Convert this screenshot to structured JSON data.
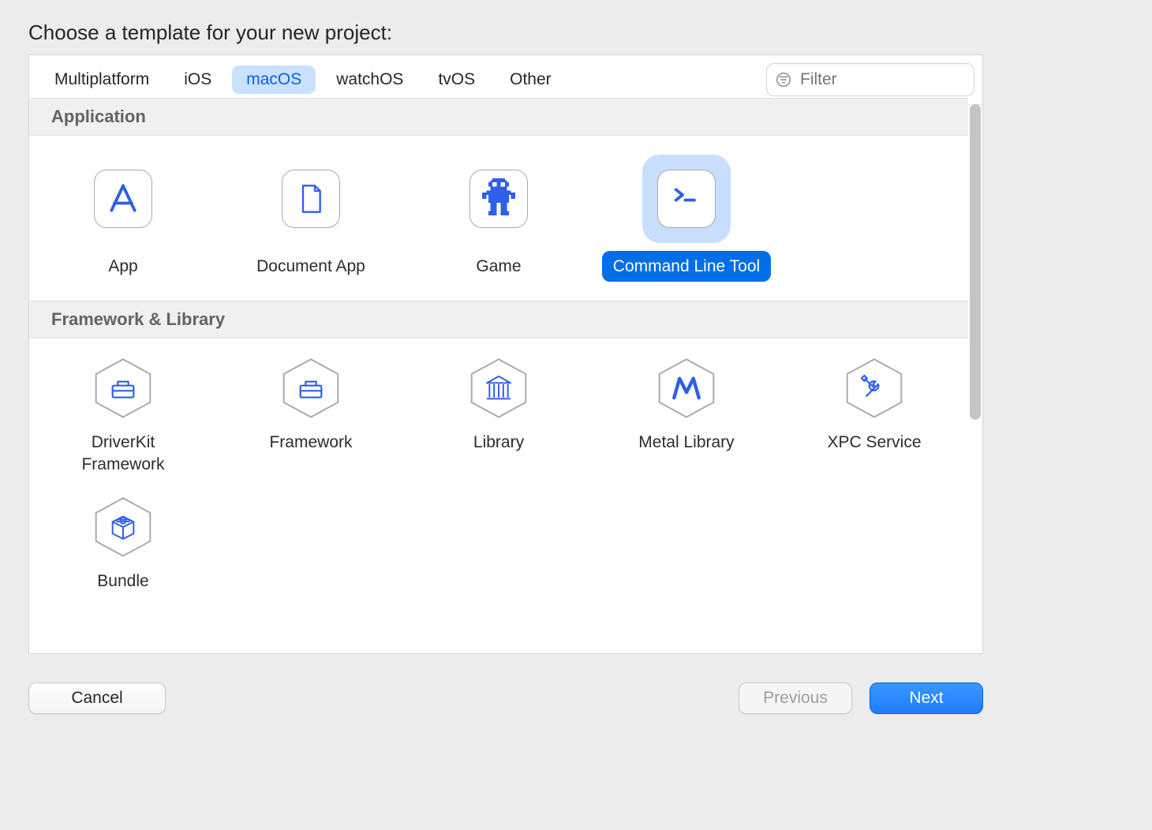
{
  "prompt": "Choose a template for your new project:",
  "tabs": [
    "Multiplatform",
    "iOS",
    "macOS",
    "watchOS",
    "tvOS",
    "Other"
  ],
  "active_tab": "macOS",
  "filter_placeholder": "Filter",
  "sections": {
    "application": {
      "title": "Application",
      "items": [
        {
          "label": "App",
          "icon": "app-a-icon",
          "selected": false
        },
        {
          "label": "Document App",
          "icon": "document-icon",
          "selected": false
        },
        {
          "label": "Game",
          "icon": "game-sprite-icon",
          "selected": false
        },
        {
          "label": "Command Line Tool",
          "icon": "terminal-icon",
          "selected": true
        }
      ]
    },
    "frameworks": {
      "title": "Framework & Library",
      "items": [
        {
          "label": "DriverKit Framework",
          "icon": "toolbox-icon"
        },
        {
          "label": "Framework",
          "icon": "toolbox-icon"
        },
        {
          "label": "Library",
          "icon": "library-columns-icon"
        },
        {
          "label": "Metal Library",
          "icon": "metal-m-icon"
        },
        {
          "label": "XPC Service",
          "icon": "wrench-screwdriver-icon"
        },
        {
          "label": "Bundle",
          "icon": "lego-brick-icon"
        }
      ]
    }
  },
  "buttons": {
    "cancel": "Cancel",
    "previous": "Previous",
    "next": "Next"
  },
  "colors": {
    "accent": "#006ee6",
    "icon_blue": "#2f5fe8"
  }
}
